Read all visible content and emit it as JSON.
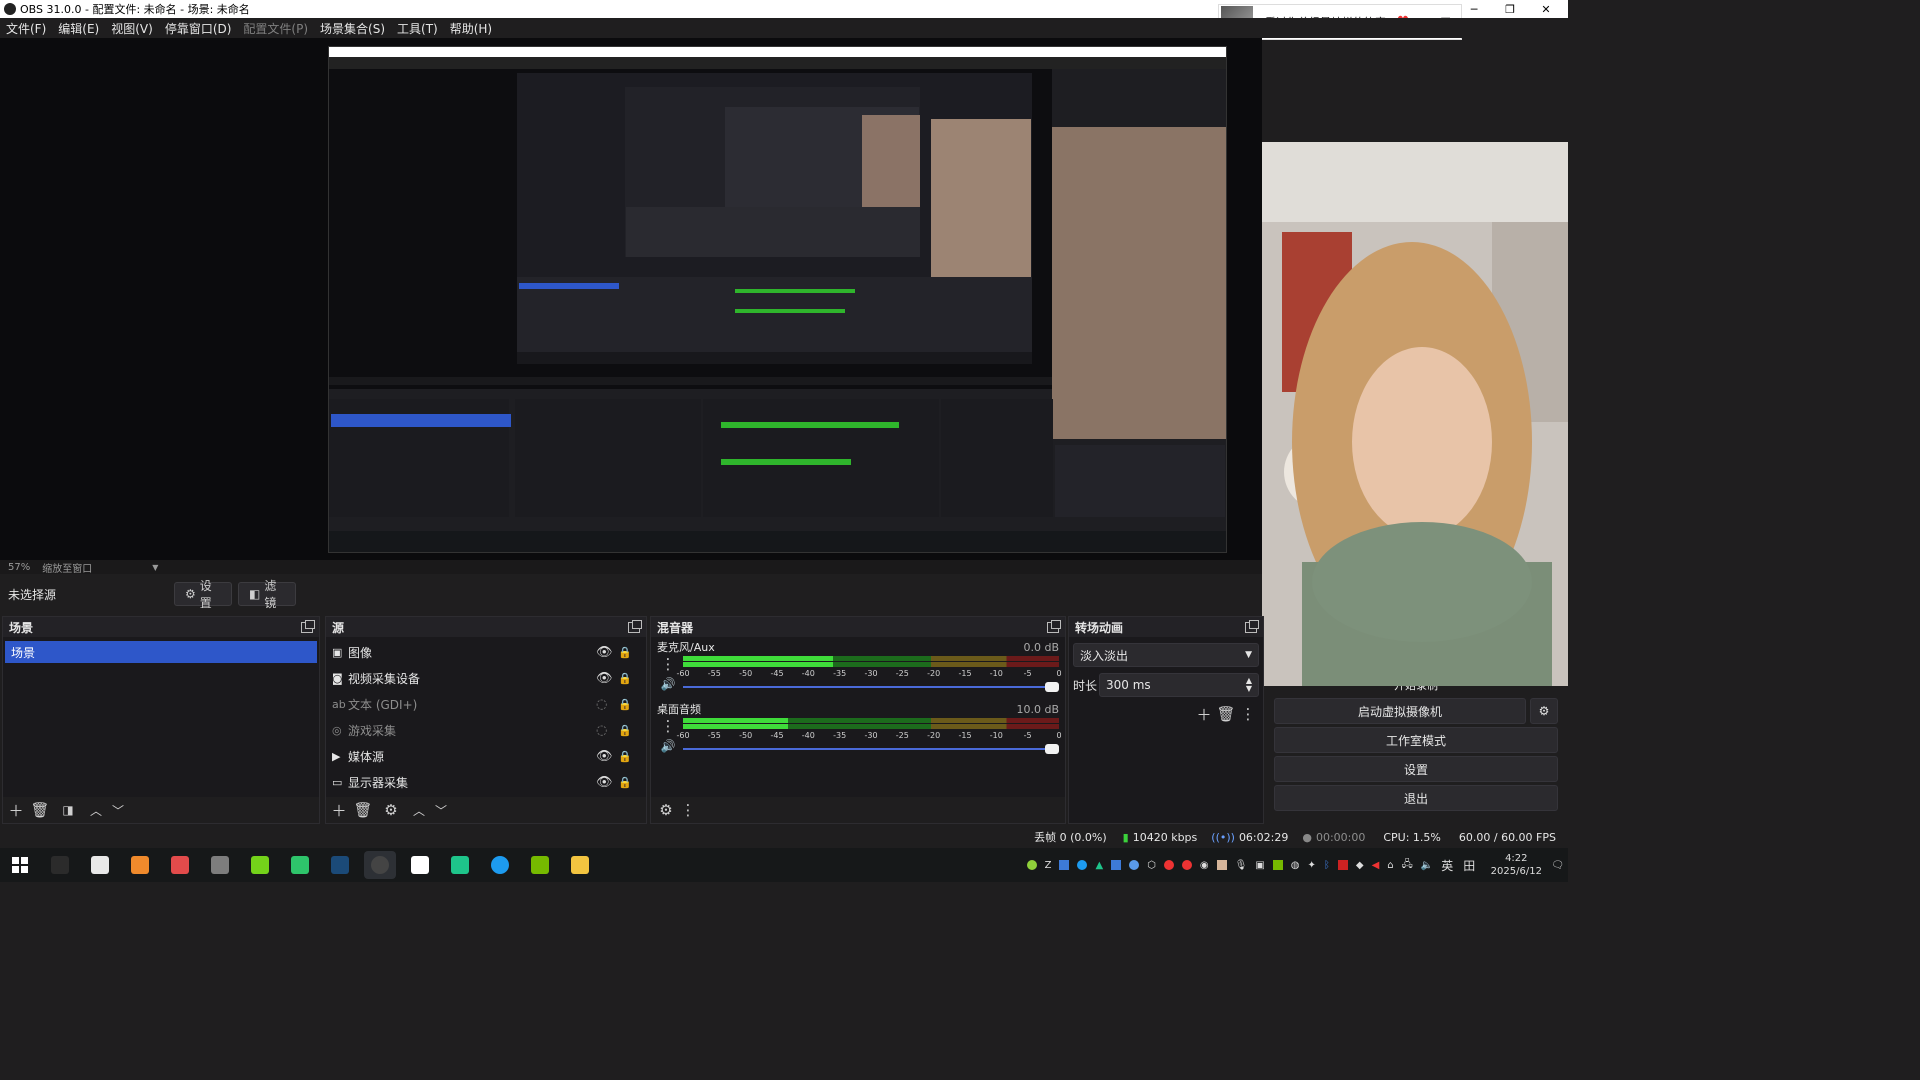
{
  "window": {
    "title": "OBS 31.0.0 - 配置文件: 未命名 - 场景: 未命名",
    "minimize": "─",
    "restore": "❐",
    "close": "✕"
  },
  "music": {
    "title": "看过你曾经最灿烂的笑容"
  },
  "menu": {
    "items": [
      {
        "label": "文件(F)",
        "enabled": true
      },
      {
        "label": "编辑(E)",
        "enabled": true
      },
      {
        "label": "视图(V)",
        "enabled": true
      },
      {
        "label": "停靠窗口(D)",
        "enabled": true
      },
      {
        "label": "配置文件(P)",
        "enabled": false
      },
      {
        "label": "场景集合(S)",
        "enabled": true
      },
      {
        "label": "工具(T)",
        "enabled": true
      },
      {
        "label": "帮助(H)",
        "enabled": true
      }
    ]
  },
  "zoom": {
    "percent": "57%",
    "mode": "缩放至窗口"
  },
  "context": {
    "source": "未选择源",
    "settings_btn": "设置",
    "filters_btn": "滤镜"
  },
  "scenes": {
    "title": "场景",
    "items": [
      "场景"
    ]
  },
  "sources": {
    "title": "源",
    "items": [
      {
        "label": "图像",
        "icon": "image-icon",
        "glyph": "▣",
        "visible": true,
        "locked": false,
        "dim": false
      },
      {
        "label": "视频采集设备",
        "icon": "camera-icon",
        "glyph": "◙",
        "visible": true,
        "locked": false,
        "dim": false
      },
      {
        "label": "文本 (GDI+)",
        "icon": "text-icon",
        "glyph": "ab",
        "visible": false,
        "locked": false,
        "dim": true
      },
      {
        "label": "游戏采集",
        "icon": "gamepad-icon",
        "glyph": "◎",
        "visible": false,
        "locked": true,
        "dim": true
      },
      {
        "label": "媒体源",
        "icon": "play-icon",
        "glyph": "▶",
        "visible": true,
        "locked": false,
        "dim": false
      },
      {
        "label": "显示器采集",
        "icon": "monitor-icon",
        "glyph": "▭",
        "visible": true,
        "locked": true,
        "dim": false
      }
    ]
  },
  "mixer": {
    "title": "混音器",
    "scale": [
      "-60",
      "-55",
      "-50",
      "-45",
      "-40",
      "-35",
      "-30",
      "-25",
      "-20",
      "-15",
      "-10",
      "-5",
      "0"
    ],
    "channels": [
      {
        "name": "麦克风/Aux",
        "db": "0.0 dB",
        "level": 0.4
      },
      {
        "name": "桌面音频",
        "db": "10.0 dB",
        "level": 0.28
      }
    ]
  },
  "transitions": {
    "title": "转场动画",
    "selected": "淡入淡出",
    "duration_label": "时长",
    "duration": "300 ms"
  },
  "controls": {
    "partial_hidden": "开始录制",
    "virtual_cam": "启动虚拟摄像机",
    "studio": "工作室模式",
    "settings": "设置",
    "exit": "退出"
  },
  "status": {
    "dropped": "丢帧 0 (0.0%)",
    "bitrate": "10420 kbps",
    "stream_time": "06:02:29",
    "rec_time": "00:00:00",
    "cpu": "CPU: 1.5%",
    "fps": "60.00 / 60.00 FPS"
  },
  "taskbar": {
    "time": "4:22",
    "date": "2025/6/12",
    "ime": "英",
    "apps": [
      {
        "name": "taskview-icon",
        "color": "#2b2b2b"
      },
      {
        "name": "zlibrary-icon",
        "color": "#e8e8e8"
      },
      {
        "name": "browser-icon",
        "color": "#f08a2c"
      },
      {
        "name": "calc-icon",
        "color": "#e24b4b"
      },
      {
        "name": "tool-icon",
        "color": "#7d7d7d"
      },
      {
        "name": "emu-icon",
        "color": "#74d21a"
      },
      {
        "name": "aircraft-icon",
        "color": "#2ec46b"
      },
      {
        "name": "steam-icon",
        "color": "#1b4a78"
      },
      {
        "name": "obs-icon",
        "color": "#444444"
      },
      {
        "name": "qq-icon",
        "color": "#ffffff"
      },
      {
        "name": "green-tri-icon",
        "color": "#1ec48a"
      },
      {
        "name": "chat-icon",
        "color": "#1d9bf0"
      },
      {
        "name": "nvidia-icon",
        "color": "#76b900"
      },
      {
        "name": "folder-icon",
        "color": "#f3c440"
      }
    ]
  }
}
